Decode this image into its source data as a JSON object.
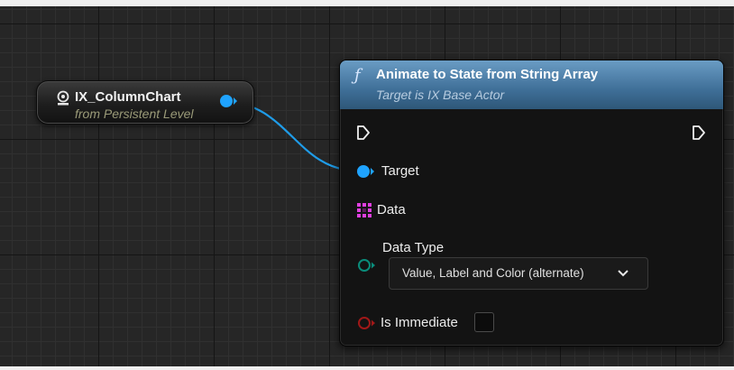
{
  "actor_ref": {
    "title": "IX_ColumnChart",
    "subtitle": "from Persistent Level",
    "icon": "actor-reference-icon"
  },
  "function_node": {
    "icon": "function-icon",
    "icon_glyph": "ƒ",
    "title": "Animate to State from String Array",
    "target_subtitle": "Target is IX Base Actor",
    "header_color": "#4a7aa3",
    "pins": {
      "target": {
        "label": "Target",
        "color": "#1fa3ff"
      },
      "data": {
        "label": "Data",
        "color": "#e040e0"
      },
      "data_type": {
        "label": "Data Type",
        "value": "Value, Label and Color (alternate)",
        "color": "#0a8c7a"
      },
      "is_immediate": {
        "label": "Is Immediate",
        "checked": false,
        "color": "#a01818"
      }
    }
  },
  "wire_color": "#1f9ce8"
}
